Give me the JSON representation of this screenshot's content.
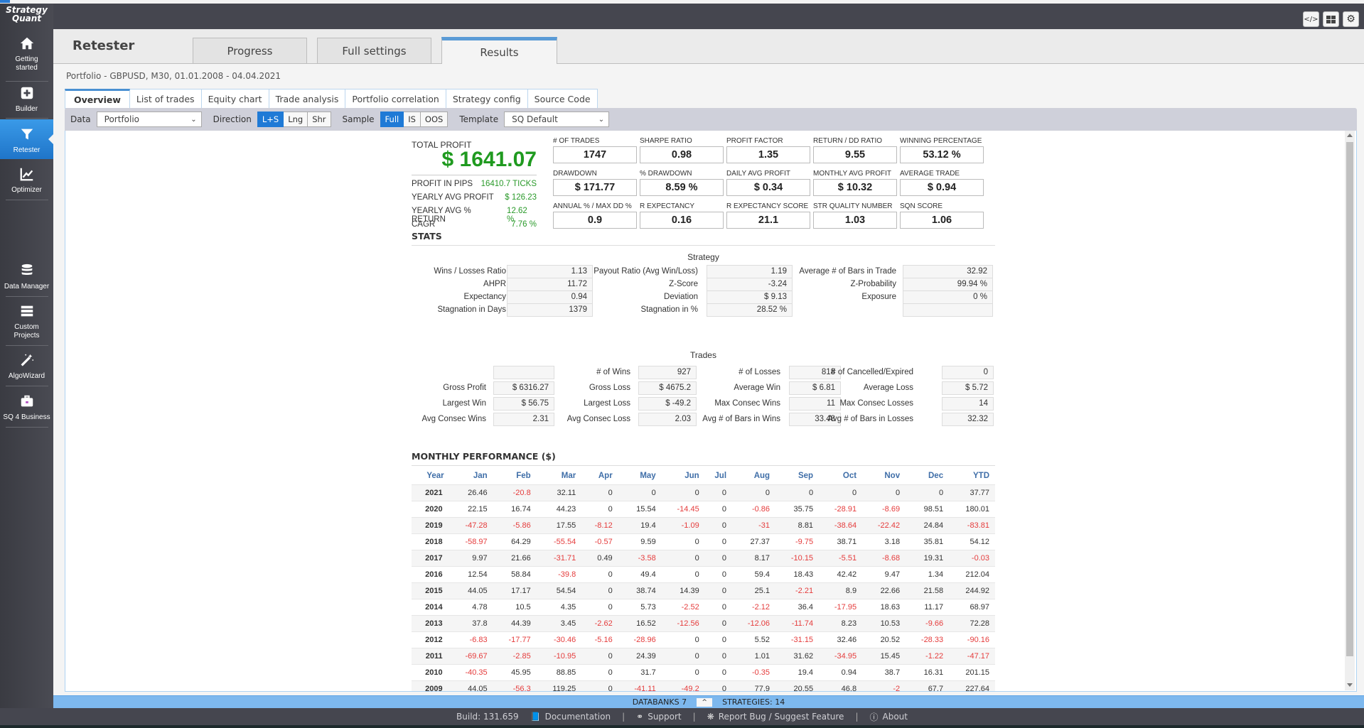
{
  "app": {
    "logo_line1": "Strategy",
    "logo_line2": "Quant"
  },
  "sidebar": {
    "items": [
      {
        "label_line1": "Getting",
        "label_line2": "started",
        "icon": "home-icon"
      },
      {
        "label_line1": "Builder",
        "label_line2": "",
        "icon": "plus-square-icon"
      },
      {
        "label_line1": "Retester",
        "label_line2": "",
        "icon": "filter-icon",
        "active": true
      },
      {
        "label_line1": "Optimizer",
        "label_line2": "",
        "icon": "chart-line-icon"
      },
      {
        "label_line1": "Data Manager",
        "label_line2": "",
        "icon": "database-icon"
      },
      {
        "label_line1": "Custom",
        "label_line2": "Projects",
        "icon": "server-icon"
      },
      {
        "label_line1": "AlgoWizard",
        "label_line2": "",
        "icon": "magic-wand-icon"
      },
      {
        "label_line1": "SQ 4 Business",
        "label_line2": "",
        "icon": "briefcase-icon"
      }
    ]
  },
  "topbar": {
    "buttons": [
      {
        "icon": "code-icon",
        "glyph": "</>"
      },
      {
        "icon": "grid-icon",
        "glyph": "▦"
      },
      {
        "icon": "gear-icon",
        "glyph": "⚙"
      }
    ]
  },
  "header": {
    "title": "Retester",
    "tabs": [
      {
        "label": "Progress"
      },
      {
        "label": "Full settings"
      },
      {
        "label": "Results",
        "active": true
      }
    ],
    "subtitle": "Portfolio - GBPUSD, M30, 01.01.2008 - 04.04.2021"
  },
  "subtabs": [
    {
      "label": "Overview",
      "active": true
    },
    {
      "label": "List of trades"
    },
    {
      "label": "Equity chart"
    },
    {
      "label": "Trade analysis"
    },
    {
      "label": "Portfolio correlation"
    },
    {
      "label": "Strategy config"
    },
    {
      "label": "Source Code"
    }
  ],
  "toolbar": {
    "data_label": "Data",
    "data_value": "Portfolio",
    "direction_label": "Direction",
    "direction_options": [
      "L+S",
      "Lng",
      "Shr"
    ],
    "direction_selected": "L+S",
    "sample_label": "Sample",
    "sample_options": [
      "Full",
      "IS",
      "OOS"
    ],
    "sample_selected": "Full",
    "template_label": "Template",
    "template_value": "SQ Default"
  },
  "overview": {
    "total_profit_label": "TOTAL PROFIT",
    "total_profit_value": "$ 1641.07",
    "summary": [
      {
        "label": "PROFIT IN PIPS",
        "value": "16410.7 TICKS"
      },
      {
        "label": "YEARLY AVG PROFIT",
        "value": "$ 126.23"
      },
      {
        "label": "YEARLY AVG % RETURN",
        "value": "12.62 %"
      },
      {
        "label": "CAGR",
        "value": "7.76 %"
      }
    ],
    "metrics": [
      {
        "label": "# OF TRADES",
        "value": "1747"
      },
      {
        "label": "SHARPE RATIO",
        "value": "0.98"
      },
      {
        "label": "PROFIT FACTOR",
        "value": "1.35"
      },
      {
        "label": "RETURN / DD RATIO",
        "value": "9.55"
      },
      {
        "label": "WINNING PERCENTAGE",
        "value": "53.12 %"
      },
      {
        "label": "DRAWDOWN",
        "value": "$ 171.77"
      },
      {
        "label": "% DRAWDOWN",
        "value": "8.59 %"
      },
      {
        "label": "DAILY AVG PROFIT",
        "value": "$ 0.34"
      },
      {
        "label": "MONTHLY AVG PROFIT",
        "value": "$ 10.32"
      },
      {
        "label": "AVERAGE TRADE",
        "value": "$ 0.94"
      },
      {
        "label": "ANNUAL % / MAX DD %",
        "value": "0.9"
      },
      {
        "label": "R EXPECTANCY",
        "value": "0.16"
      },
      {
        "label": "R EXPECTANCY SCORE",
        "value": "21.1"
      },
      {
        "label": "STR QUALITY NUMBER",
        "value": "1.03"
      },
      {
        "label": "SQN SCORE",
        "value": "1.06"
      }
    ]
  },
  "stats": {
    "title": "STATS",
    "strategy_title": "Strategy",
    "strategy_rows": [
      [
        {
          "label": "Wins / Losses Ratio",
          "value": "1.13"
        },
        {
          "label": "Payout Ratio (Avg Win/Loss)",
          "value": "1.19"
        },
        {
          "label": "Average # of Bars in Trade",
          "value": "32.92"
        }
      ],
      [
        {
          "label": "AHPR",
          "value": "11.72"
        },
        {
          "label": "Z-Score",
          "value": "-3.24"
        },
        {
          "label": "Z-Probability",
          "value": "99.94 %"
        }
      ],
      [
        {
          "label": "Expectancy",
          "value": "0.94"
        },
        {
          "label": "Deviation",
          "value": "$ 9.13"
        },
        {
          "label": "Exposure",
          "value": "0 %"
        }
      ],
      [
        {
          "label": "Stagnation in Days",
          "value": "1379"
        },
        {
          "label": "Stagnation in %",
          "value": "28.52 %"
        },
        {
          "label": "",
          "value": ""
        }
      ]
    ],
    "trades_title": "Trades",
    "trades_rows": [
      [
        {
          "label": "",
          "value": ""
        },
        {
          "label": "# of Wins",
          "value": "927"
        },
        {
          "label": "# of Losses",
          "value": "818"
        },
        {
          "label": "# of Cancelled/Expired",
          "value": "0"
        }
      ],
      [
        {
          "label": "Gross Profit",
          "value": "$ 6316.27"
        },
        {
          "label": "Gross Loss",
          "value": "$ 4675.2"
        },
        {
          "label": "Average Win",
          "value": "$ 6.81"
        },
        {
          "label": "Average Loss",
          "value": "$ 5.72"
        }
      ],
      [
        {
          "label": "Largest Win",
          "value": "$ 56.75"
        },
        {
          "label": "Largest Loss",
          "value": "$ -49.2"
        },
        {
          "label": "Max Consec Wins",
          "value": "11"
        },
        {
          "label": "Max Consec Losses",
          "value": "14"
        }
      ],
      [
        {
          "label": "Avg Consec Wins",
          "value": "2.31"
        },
        {
          "label": "Avg Consec Loss",
          "value": "2.03"
        },
        {
          "label": "Avg # of Bars in Wins",
          "value": "33.48"
        },
        {
          "label": "Avg # of Bars in Losses",
          "value": "32.32"
        }
      ]
    ]
  },
  "monthly": {
    "title": "MONTHLY PERFORMANCE ($)",
    "headers": [
      "Year",
      "Jan",
      "Feb",
      "Mar",
      "Apr",
      "May",
      "Jun",
      "Jul",
      "Aug",
      "Sep",
      "Oct",
      "Nov",
      "Dec",
      "YTD"
    ],
    "rows": [
      [
        "2021",
        "26.46",
        "-20.8",
        "32.11",
        "0",
        "0",
        "0",
        "0",
        "0",
        "0",
        "0",
        "0",
        "0",
        "37.77"
      ],
      [
        "2020",
        "22.15",
        "16.74",
        "44.23",
        "0",
        "15.54",
        "-14.45",
        "0",
        "-0.86",
        "35.75",
        "-28.91",
        "-8.69",
        "98.51",
        "180.01"
      ],
      [
        "2019",
        "-47.28",
        "-5.86",
        "17.55",
        "-8.12",
        "19.4",
        "-1.09",
        "0",
        "-31",
        "8.81",
        "-38.64",
        "-22.42",
        "24.84",
        "-83.81"
      ],
      [
        "2018",
        "-58.97",
        "64.29",
        "-55.54",
        "-0.57",
        "9.59",
        "0",
        "0",
        "27.37",
        "-9.75",
        "38.71",
        "3.18",
        "35.81",
        "54.12"
      ],
      [
        "2017",
        "9.97",
        "21.66",
        "-31.71",
        "0.49",
        "-3.58",
        "0",
        "0",
        "8.17",
        "-10.15",
        "-5.51",
        "-8.68",
        "19.31",
        "-0.03"
      ],
      [
        "2016",
        "12.54",
        "58.84",
        "-39.8",
        "0",
        "49.4",
        "0",
        "0",
        "59.4",
        "18.43",
        "42.42",
        "9.47",
        "1.34",
        "212.04"
      ],
      [
        "2015",
        "44.05",
        "17.17",
        "54.54",
        "0",
        "38.74",
        "14.39",
        "0",
        "25.1",
        "-2.21",
        "8.9",
        "22.66",
        "21.58",
        "244.92"
      ],
      [
        "2014",
        "4.78",
        "10.5",
        "4.35",
        "0",
        "5.73",
        "-2.52",
        "0",
        "-2.12",
        "36.4",
        "-17.95",
        "18.63",
        "11.17",
        "68.97"
      ],
      [
        "2013",
        "37.8",
        "44.39",
        "3.45",
        "-2.62",
        "16.52",
        "-12.56",
        "0",
        "-12.06",
        "-11.74",
        "8.23",
        "10.53",
        "-9.66",
        "72.28"
      ],
      [
        "2012",
        "-6.83",
        "-17.77",
        "-30.46",
        "-5.16",
        "-28.96",
        "0",
        "0",
        "5.52",
        "-31.15",
        "32.46",
        "20.52",
        "-28.33",
        "-90.16"
      ],
      [
        "2011",
        "-69.67",
        "-2.85",
        "-10.95",
        "0",
        "24.39",
        "0",
        "0",
        "1.01",
        "31.62",
        "-34.95",
        "15.45",
        "-1.22",
        "-47.17"
      ],
      [
        "2010",
        "-40.35",
        "45.95",
        "88.85",
        "0",
        "31.7",
        "0",
        "0",
        "-0.35",
        "19.4",
        "0.94",
        "38.7",
        "16.31",
        "201.15"
      ],
      [
        "2009",
        "44.05",
        "-56.3",
        "119.25",
        "0",
        "-41.11",
        "-49.2",
        "0",
        "77.9",
        "20.55",
        "46.8",
        "-2",
        "67.7",
        "227.64"
      ]
    ]
  },
  "databank_bar": {
    "databanks": "DATABANKS 7",
    "toggle_glyph": "^",
    "strategies": "STRATEGIES: 14"
  },
  "footer": {
    "build": "Build: 131.659",
    "documentation": "Documentation",
    "support": "Support",
    "report": "Report Bug / Suggest Feature",
    "about": "About",
    "separator": "|"
  },
  "colors": {
    "accent": "#1f7ad6",
    "profit_green": "#1f9a1f",
    "negative_red": "#e53c3c",
    "header_blue": "#3f6ea8",
    "sidebar_bg": "#45464f"
  }
}
